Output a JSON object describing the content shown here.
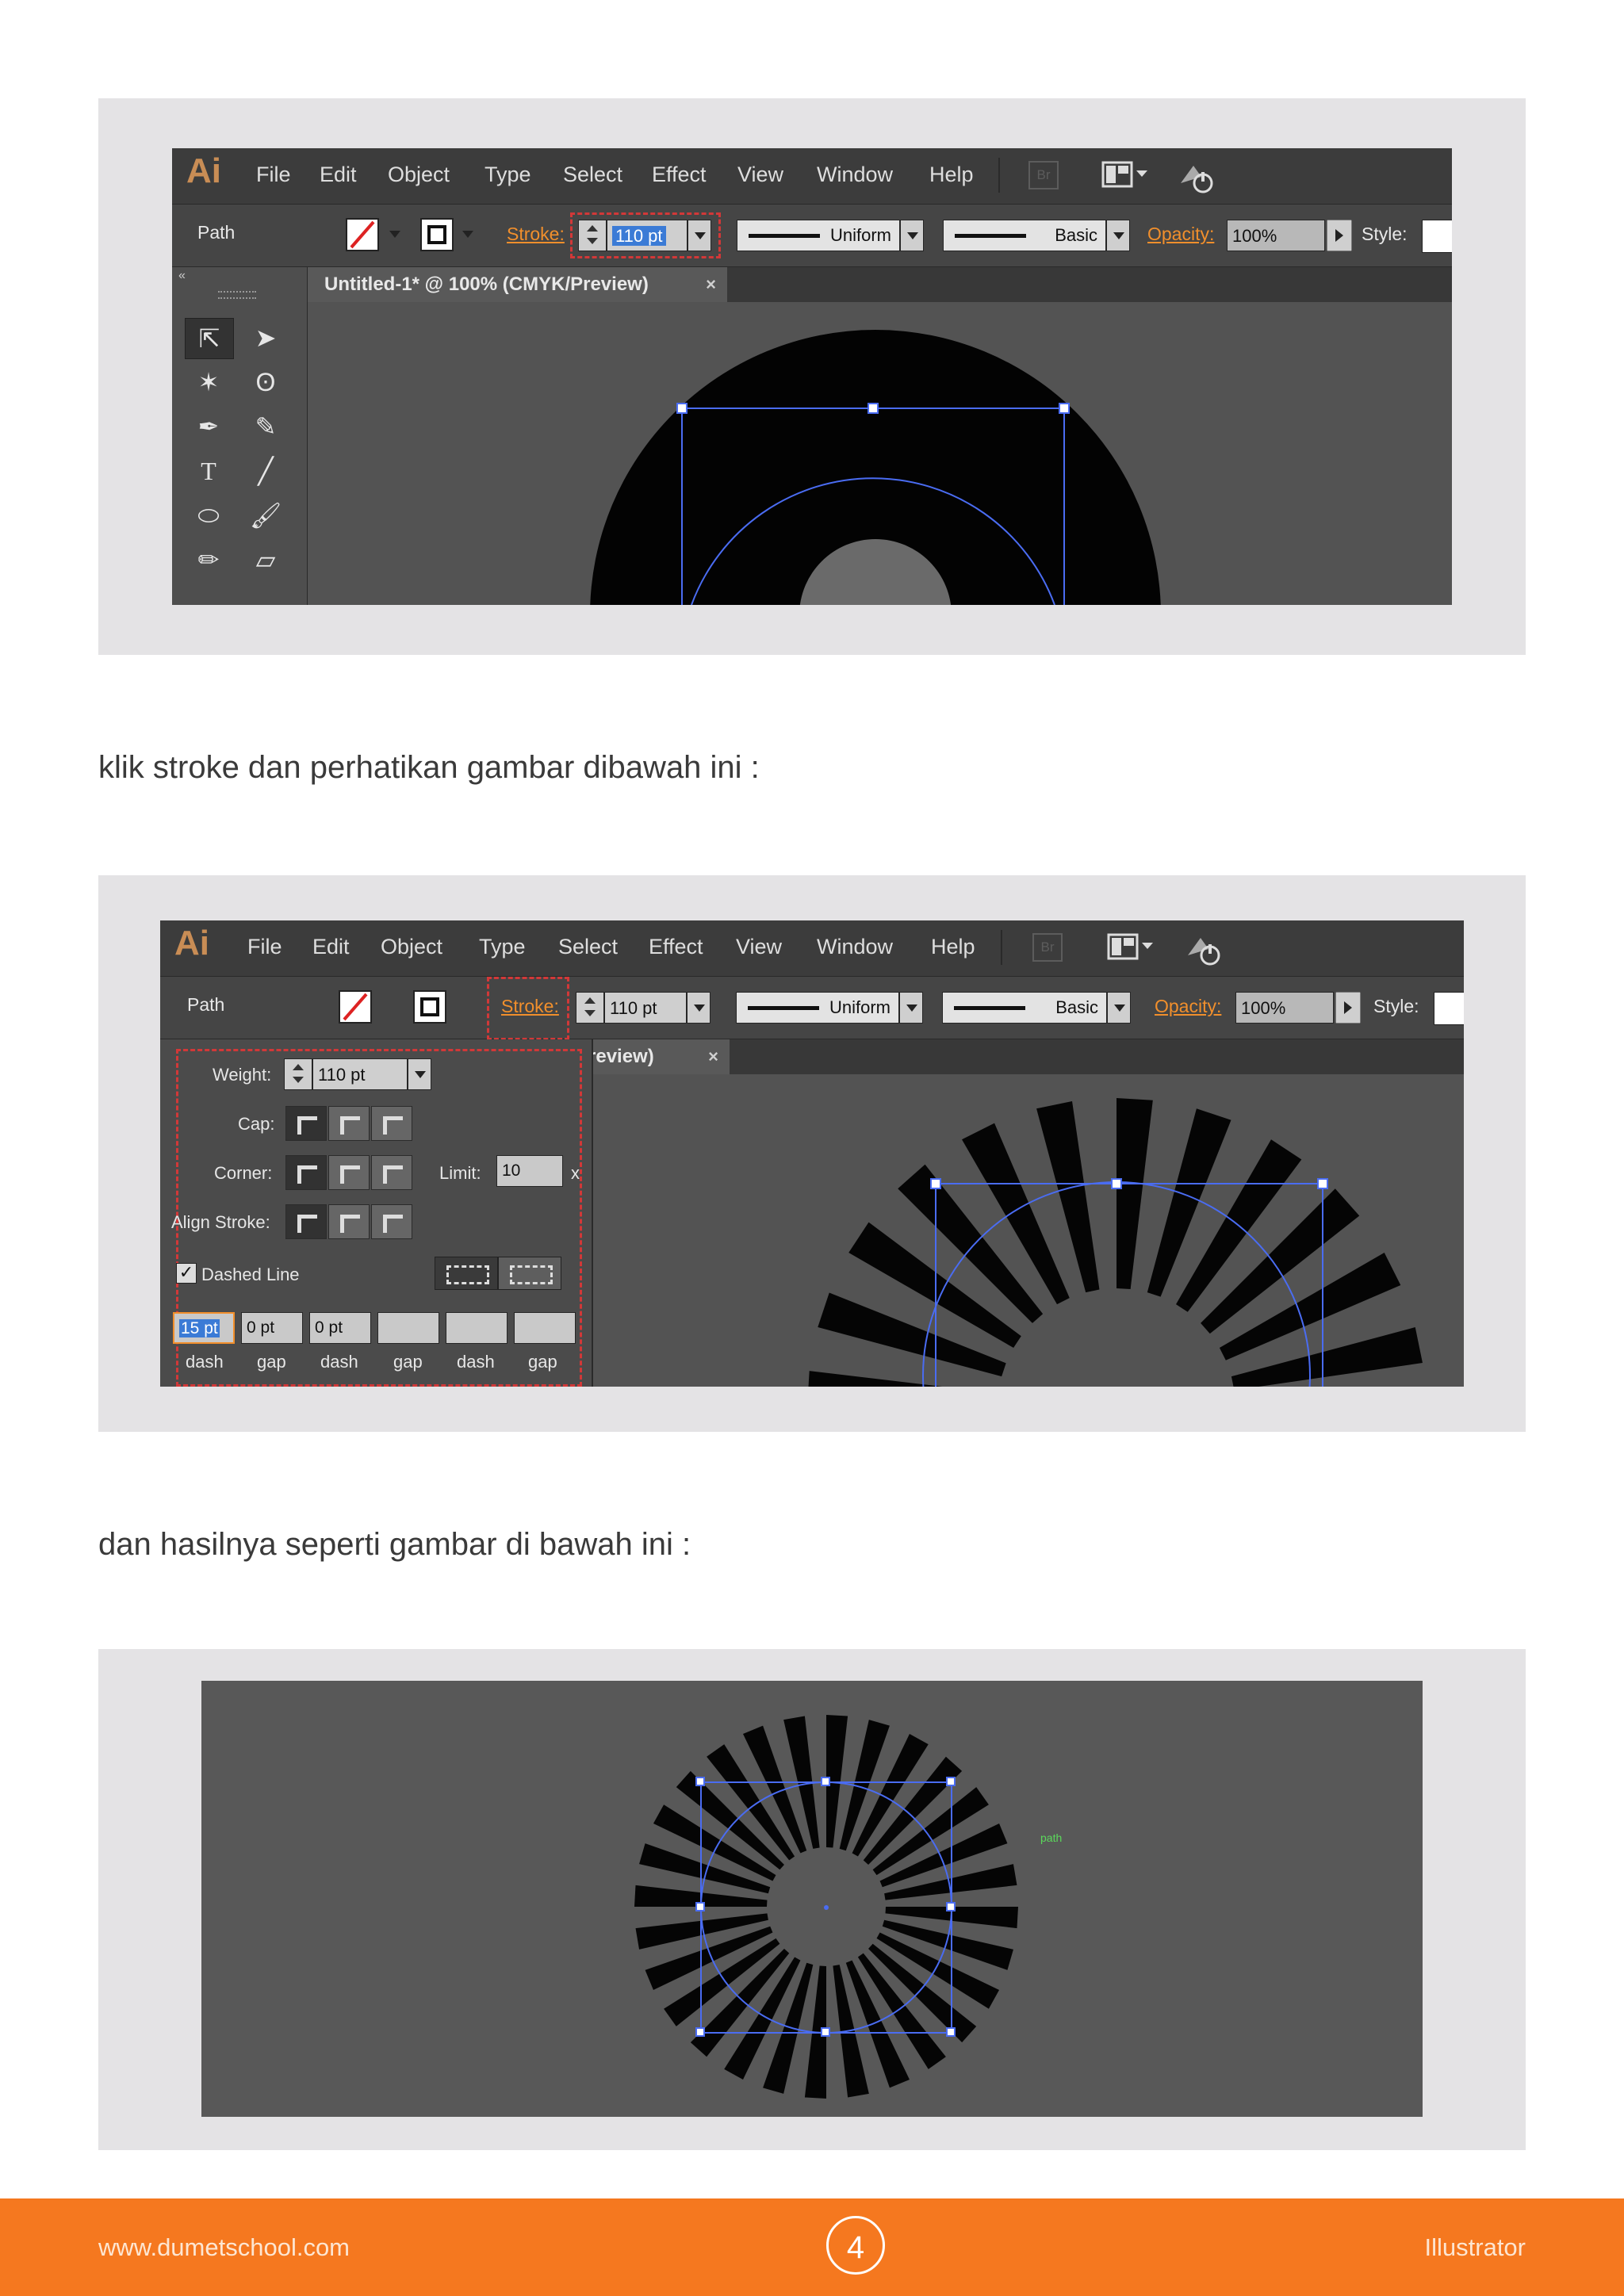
{
  "shot1": {
    "app_logo": "Ai",
    "menu": [
      "File",
      "Edit",
      "Object",
      "Type",
      "Select",
      "Effect",
      "View",
      "Window",
      "Help"
    ],
    "br_label": "Br",
    "control": {
      "object_type": "Path",
      "stroke_label": "Stroke:",
      "stroke_value": "110 pt",
      "profile_label": "Uniform",
      "brush_label": "Basic",
      "opacity_label": "Opacity:",
      "opacity_value": "100%",
      "style_label": "Style:"
    },
    "doc_tab": "Untitled-1* @ 100% (CMYK/Preview)",
    "tab_close": "×"
  },
  "caption1": "klik stroke dan perhatikan gambar dibawah ini :",
  "shot2": {
    "app_logo": "Ai",
    "menu": [
      "File",
      "Edit",
      "Object",
      "Type",
      "Select",
      "Effect",
      "View",
      "Window",
      "Help"
    ],
    "br_label": "Br",
    "control": {
      "object_type": "Path",
      "stroke_label": "Stroke:",
      "stroke_value": "110 pt",
      "profile_label": "Uniform",
      "brush_label": "Basic",
      "opacity_label": "Opacity:",
      "opacity_value": "100%",
      "style_label": "Style:"
    },
    "doc_tab_partial": "review)",
    "tab_close": "×",
    "stroke_panel": {
      "weight_label": "Weight:",
      "weight_value": "110 pt",
      "cap_label": "Cap:",
      "corner_label": "Corner:",
      "limit_label": "Limit:",
      "limit_value": "10",
      "limit_unit": "x",
      "align_label": "Align Stroke:",
      "dashed_label": "Dashed Line",
      "dashed_checked": true,
      "dash_values": [
        "15 pt",
        "0 pt",
        "0 pt",
        "",
        "",
        ""
      ],
      "dash_labels": [
        "dash",
        "gap",
        "dash",
        "gap",
        "dash",
        "gap"
      ]
    }
  },
  "caption2": "dan hasilnya seperti gambar di bawah ini :",
  "shot3": {
    "path_label": "path"
  },
  "footer": {
    "website": "www.dumetschool.com",
    "page_number": "4",
    "topic": "Illustrator"
  },
  "colors": {
    "footer_bg": "#f5781f",
    "accent_orange": "#f18f2c",
    "selection_blue": "#4a6cf2",
    "dashed_red": "#d23838"
  }
}
